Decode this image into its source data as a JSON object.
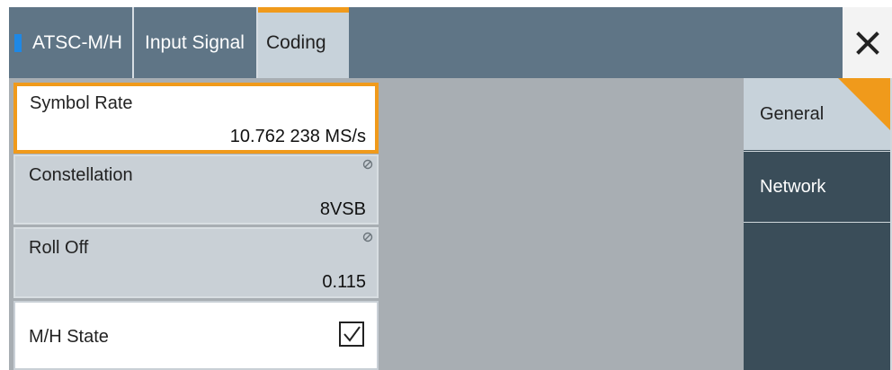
{
  "tabs": {
    "items": [
      {
        "label": "ATSC-M/H"
      },
      {
        "label": "Input Signal"
      },
      {
        "label": "Coding"
      }
    ],
    "active": "Coding",
    "close_icon": "close-icon"
  },
  "parameters": {
    "symbol_rate": {
      "label": "Symbol Rate",
      "value": "10.762 238 MS/s"
    },
    "constellation": {
      "label": "Constellation",
      "value": "8VSB",
      "icon": "not-editable-icon"
    },
    "roll_off": {
      "label": "Roll Off",
      "value": "0.115",
      "icon": "not-editable-icon"
    },
    "mh_state": {
      "label": "M/H State",
      "checked": true
    }
  },
  "side_nav": {
    "items": [
      {
        "label": "General"
      },
      {
        "label": "Network"
      }
    ],
    "active": "General"
  },
  "colors": {
    "accent": "#f09a1b",
    "tabbar": "#5f7586",
    "active_tab": "#c7d2da",
    "panel_bg": "#a8aeb3",
    "sidenav": "#3a4d59",
    "marker": "#1e88e5"
  }
}
